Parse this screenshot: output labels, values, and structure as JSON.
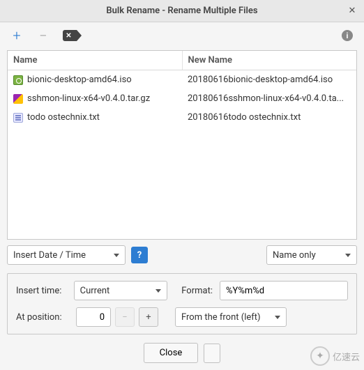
{
  "window": {
    "title": "Bulk Rename - Rename Multiple Files"
  },
  "table": {
    "headers": {
      "name": "Name",
      "new_name": "New Name"
    },
    "rows": [
      {
        "icon": "iso",
        "name": "bionic-desktop-amd64.iso",
        "new_name": "20180616bionic-desktop-amd64.iso"
      },
      {
        "icon": "tar",
        "name": "sshmon-linux-x64-v0.4.0.tar.gz",
        "new_name": "20180616sshmon-linux-x64-v0.4.0.ta..."
      },
      {
        "icon": "txt",
        "name": "todo ostechnix.txt",
        "new_name": "20180616todo ostechnix.txt"
      }
    ]
  },
  "mode": {
    "operation": "Insert Date / Time",
    "scope": "Name only"
  },
  "params": {
    "insert_time_label": "Insert time:",
    "insert_time_value": "Current",
    "format_label": "Format:",
    "format_value": "%Y%m%d",
    "position_label": "At position:",
    "position_value": "0",
    "direction_value": "From the front (left)"
  },
  "footer": {
    "close": "Close"
  },
  "watermark": {
    "text": "亿速云"
  }
}
